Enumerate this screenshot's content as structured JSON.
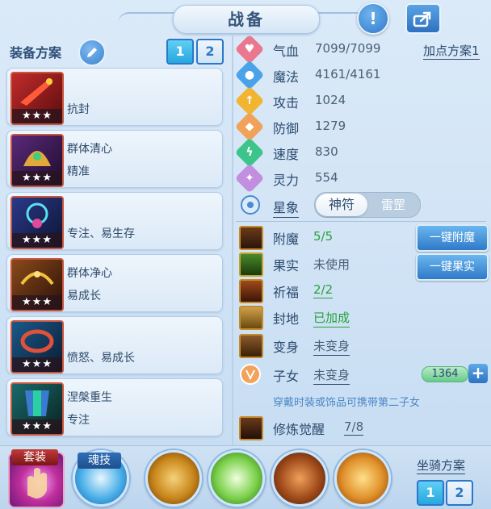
{
  "header": {
    "title": "战备",
    "info_icon": "exclamation-icon",
    "share_icon": "share-icon"
  },
  "equipment": {
    "title": "装备方案",
    "plan_buttons": [
      "1",
      "2"
    ],
    "active_plan": "1",
    "cards": [
      {
        "line1": "",
        "line2": "抗封",
        "stars": "★★★"
      },
      {
        "line1": "群体清心",
        "line2": "精准",
        "stars": "★★★"
      },
      {
        "line1": "",
        "line2": "专注、易生存",
        "stars": "★★★"
      },
      {
        "line1": "群体净心",
        "line2": "易成长",
        "stars": "★★★"
      },
      {
        "line1": "",
        "line2": "愤怒、易成长",
        "stars": "★★★"
      },
      {
        "line1": "涅槃重生",
        "line2": "专注",
        "stars": "★★★"
      }
    ]
  },
  "stats": {
    "plan_link": "加点方案1",
    "items": [
      {
        "label": "气血",
        "value": "7099/7099",
        "color": "#e9788e",
        "glyph": "♥"
      },
      {
        "label": "魔法",
        "value": "4161/4161",
        "color": "#4aa3e8",
        "glyph": "●"
      },
      {
        "label": "攻击",
        "value": "1024",
        "color": "#f2b533",
        "glyph": "↑"
      },
      {
        "label": "防御",
        "value": "1279",
        "color": "#f0a25a",
        "glyph": "◆"
      },
      {
        "label": "速度",
        "value": "830",
        "color": "#3cc58a",
        "glyph": "ϟ"
      },
      {
        "label": "灵力",
        "value": "554",
        "color": "#c28ee0",
        "glyph": "✦"
      }
    ],
    "star_label": "星象",
    "toggle": {
      "on": "神符",
      "off": "雷罡"
    }
  },
  "enhance": [
    {
      "label": "附魔",
      "value": "5/5",
      "tone": "green"
    },
    {
      "label": "果实",
      "value": "未使用",
      "tone": "grey"
    },
    {
      "label": "祈福",
      "value": "2/2",
      "tone": "green"
    },
    {
      "label": "封地",
      "value": "已加成",
      "tone": "green"
    },
    {
      "label": "变身",
      "value": "未变身",
      "tone": "grey"
    }
  ],
  "actions": {
    "enchant_all": "一键附魔",
    "fruit_all": "一键果实"
  },
  "child": {
    "label": "子女",
    "value": "未变身",
    "count": "1364",
    "hint": "穿戴时装或饰品可携带第二子女"
  },
  "awaken": {
    "label": "修炼觉醒",
    "value": "7/8"
  },
  "bottom": {
    "suit_label": "套装",
    "skill_label": "魂技",
    "mount_title": "坐骑方案",
    "mount_buttons": [
      "1",
      "2"
    ]
  }
}
